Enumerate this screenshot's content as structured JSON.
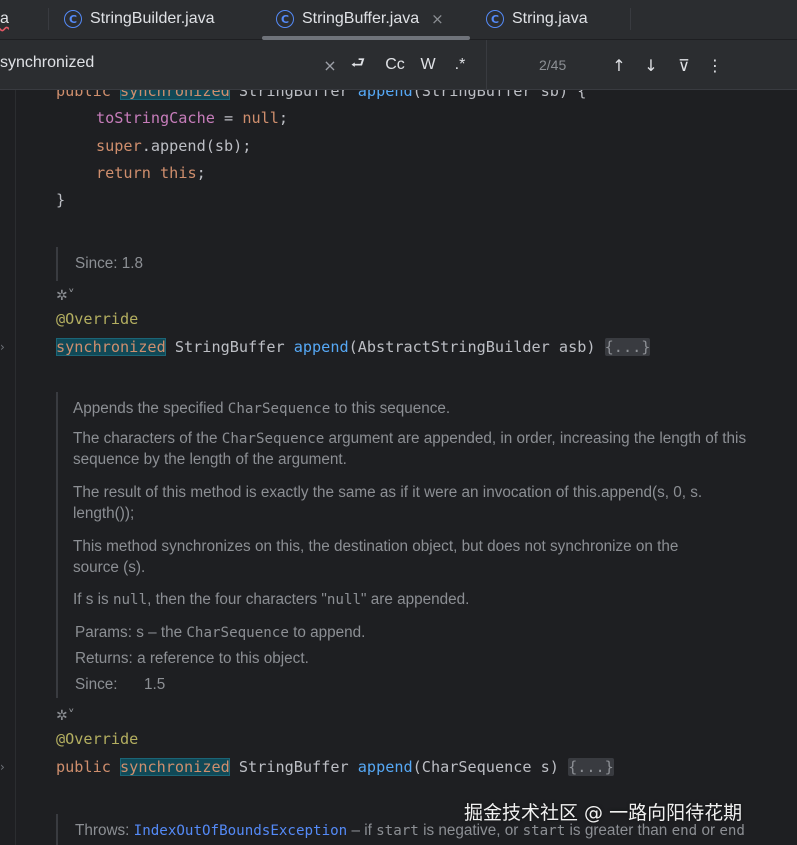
{
  "tabs": [
    {
      "label": "a",
      "icon": "",
      "active": false,
      "squiggle": true
    },
    {
      "label": "StringBuilder.java",
      "icon": "class-icon",
      "active": false
    },
    {
      "label": "StringBuffer.java",
      "icon": "class-icon",
      "active": true,
      "closable": true
    },
    {
      "label": "String.java",
      "icon": "class-icon",
      "active": false
    }
  ],
  "icons": {
    "class_glyph": "C",
    "close": "×",
    "clear": "×",
    "newline": "⮐",
    "up": "↑",
    "down": "↓",
    "filter": "⊽",
    "more": "⋮",
    "fold_arrow": "›",
    "ai": "✲˅"
  },
  "find": {
    "query": "synchronized",
    "match_case": "Cc",
    "words": "W",
    "regex": ".*",
    "count": "2/45"
  },
  "code": {
    "l1_kw": "public",
    "l1_sync": "synchronized",
    "l1_type": " StringBuffer ",
    "l1_fn": "append",
    "l1_rest": "(StringBuffer sb) {",
    "l2_field": "toStringCache",
    "l2_op": " = ",
    "l2_null": "null",
    "l2_semi": ";",
    "l3_super": "super",
    "l3_rest": ".append(sb);",
    "l4_return": "return",
    "l4_this": "this",
    "l4_semi": ";",
    "l5": "}",
    "ann1": "@Override",
    "m2_sync": "synchronized",
    "m2_type": " StringBuffer ",
    "m2_fn": "append",
    "m2_rest": "(AbstractStringBuilder asb) ",
    "m2_fold": "{...}",
    "ann2": "@Override",
    "m3_kw": "public",
    "m3_sync": "synchronized",
    "m3_type": " StringBuffer ",
    "m3_fn": "append",
    "m3_rest": "(CharSequence s) ",
    "m3_fold": "{...}"
  },
  "docs": {
    "since1": "Since: 1.8",
    "p1_a": "Appends the specified ",
    "p1_code": "CharSequence",
    "p1_b": " to this sequence.",
    "p2_a": "The characters of the ",
    "p2_code": "CharSequence",
    "p2_b": " argument are appended, in order, increasing the length of this",
    "p2_c": "sequence by the length of the argument.",
    "p3_a": "The result of this method is exactly the same as if it were an invocation of this.append(s, 0, s.",
    "p3_b": "length());",
    "p4_a": "This method synchronizes on this, the destination object, but does not synchronize on the",
    "p4_b": "source (s).",
    "p5_a": "If s is ",
    "p5_code1": "null",
    "p5_b": ", then the four characters \"",
    "p5_code2": "null",
    "p5_c": "\" are appended.",
    "params_label": "Params:",
    "params_a": "s – the ",
    "params_code": "CharSequence",
    "params_b": " to append.",
    "returns_label": "Returns:",
    "returns_text": "a reference to this object.",
    "since2_label": "Since:",
    "since2_text": "1.5",
    "throws_label": "Throws: ",
    "throws_link": "IndexOutOfBoundsException",
    "throws_a": " – if ",
    "throws_code1": "start",
    "throws_b": " is negative, or ",
    "throws_code2": "start",
    "throws_c": " is greater than ",
    "throws_code3": "end",
    "throws_d": " or ",
    "throws_code4": "end"
  },
  "watermark": "掘金技术社区 @ 一路向阳待花期"
}
